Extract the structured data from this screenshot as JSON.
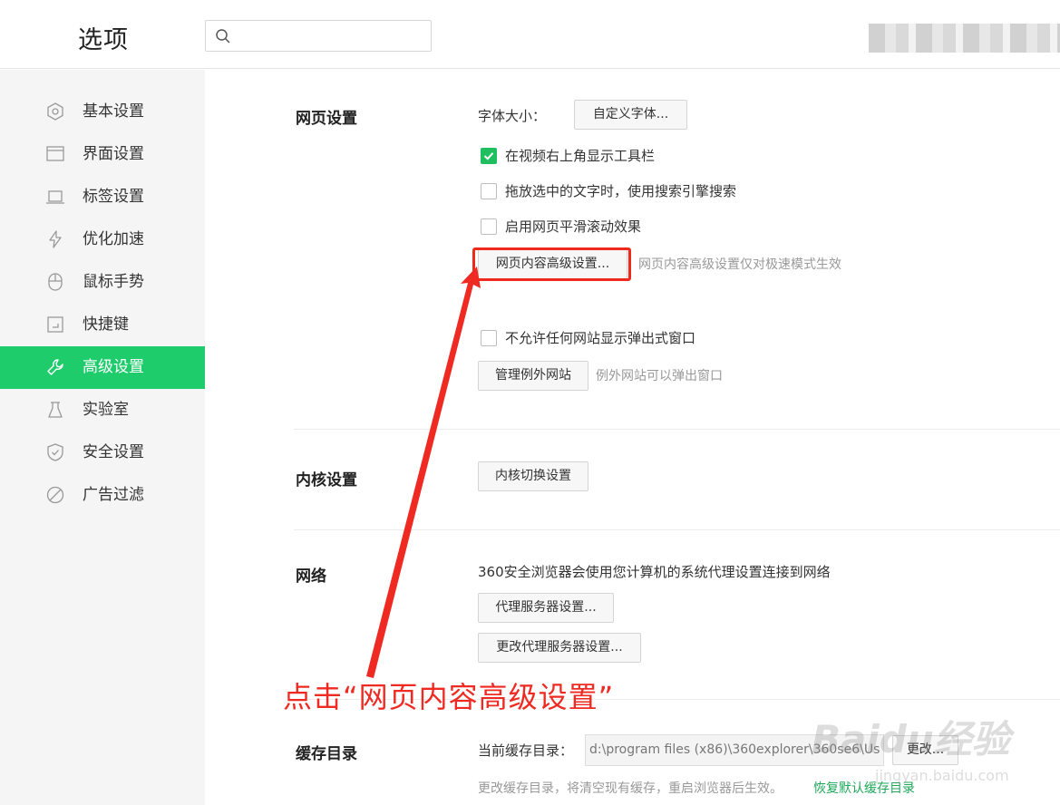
{
  "header": {
    "title": "选项",
    "search_placeholder": "",
    "search_value": ""
  },
  "sidebar": {
    "items": [
      {
        "label": "基本设置",
        "icon": "hexagon-gear-icon"
      },
      {
        "label": "界面设置",
        "icon": "window-icon"
      },
      {
        "label": "标签设置",
        "icon": "tab-icon"
      },
      {
        "label": "优化加速",
        "icon": "lightning-icon"
      },
      {
        "label": "鼠标手势",
        "icon": "mouse-icon"
      },
      {
        "label": "快捷键",
        "icon": "shortcut-key-icon"
      },
      {
        "label": "高级设置",
        "icon": "wrench-icon",
        "active": true
      },
      {
        "label": "实验室",
        "icon": "flask-icon"
      },
      {
        "label": "安全设置",
        "icon": "shield-icon"
      },
      {
        "label": "广告过滤",
        "icon": "block-icon"
      }
    ],
    "active_color": "#1fcc6b"
  },
  "sections": {
    "web": {
      "title": "网页设置",
      "font_size_label": "字体大小：",
      "custom_font_button": "自定义字体...",
      "checkbox_toolbar": "在视频右上角显示工具栏",
      "checkbox_toolbar_checked": true,
      "checkbox_drag_search": "拖放选中的文字时，使用搜索引擎搜索",
      "checkbox_drag_search_checked": false,
      "checkbox_smooth_scroll": "启用网页平滑滚动效果",
      "checkbox_smooth_scroll_checked": false,
      "advanced_content_button": "网页内容高级设置...",
      "advanced_content_hint": "网页内容高级设置仅对极速模式生效",
      "checkbox_popup": "不允许任何网站显示弹出式窗口",
      "checkbox_popup_checked": false,
      "manage_exceptions_button": "管理例外网站",
      "manage_exceptions_hint": "例外网站可以弹出窗口"
    },
    "kernel": {
      "title": "内核设置",
      "switch_button": "内核切换设置"
    },
    "network": {
      "title": "网络",
      "description": "360安全浏览器会使用您计算机的系统代理设置连接到网络",
      "proxy_button": "代理服务器设置...",
      "change_proxy_button": "更改代理服务器设置..."
    },
    "cache": {
      "title": "缓存目录",
      "current_label": "当前缓存目录：",
      "path": "d:\\program files (x86)\\360explorer\\360se6\\Us",
      "change_button": "更改...",
      "hint": "更改缓存目录，将清空现有缓存，重启浏览器后生效。",
      "restore_link": "恢复默认缓存目录"
    }
  },
  "annotation": {
    "text": "点击“网页内容高级设置”",
    "color": "#ef2a22"
  },
  "watermark": {
    "brand": "Baidu经验",
    "url": "jingyan.baidu.com"
  }
}
